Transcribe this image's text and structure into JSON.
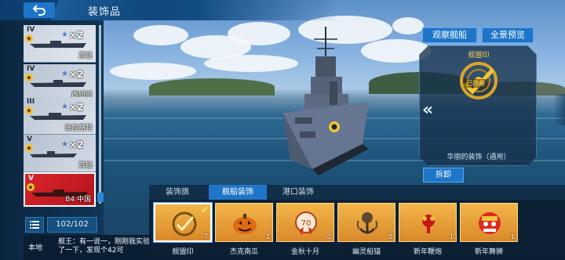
{
  "header": {
    "title": "装饰品"
  },
  "ship_list": [
    {
      "tier": "IV",
      "multiplier": "×2",
      "name": "苏联",
      "selected": false
    },
    {
      "tier": "IV",
      "multiplier": "×2",
      "name": "西姆斯",
      "selected": false
    },
    {
      "tier": "III",
      "multiplier": "×2",
      "name": "法拉格特",
      "selected": false
    },
    {
      "tier": "V",
      "multiplier": "×2",
      "name": "苏联",
      "selected": false
    },
    {
      "tier": "V",
      "multiplier": "",
      "name": "B4 中国",
      "selected": true
    }
  ],
  "ship_count": "102/102",
  "chat": {
    "channel": "本地",
    "message": "舰王：有一说一，刚刚我实验了一下，发现个42可"
  },
  "top_buttons": {
    "observe": "观察舰船",
    "panorama": "全景预览"
  },
  "detail": {
    "item_name": "舰盟印",
    "equipped_label": "已装备",
    "description": "华丽的装饰（通用）",
    "remove_button": "拆卸"
  },
  "tabs": [
    {
      "label": "装饰旗",
      "active": false
    },
    {
      "label": "舰船装饰",
      "active": true
    },
    {
      "label": "港口装饰",
      "active": false
    }
  ],
  "items": [
    {
      "label": "舰盟印",
      "count": "7",
      "equipped": true,
      "icon": "emblem-icon"
    },
    {
      "label": "杰克南瓜",
      "count": "1",
      "equipped": false,
      "icon": "pumpkin-icon"
    },
    {
      "label": "金秋十月",
      "count": "0",
      "equipped": false,
      "icon": "autumn-badge-icon"
    },
    {
      "label": "幽灵船锚",
      "count": "0",
      "equipped": false,
      "icon": "ghost-anchor-icon"
    },
    {
      "label": "新年鞭炮",
      "count": "1",
      "equipped": false,
      "icon": "firecracker-icon"
    },
    {
      "label": "新年舞狮",
      "count": "1",
      "equipped": false,
      "icon": "lion-dance-icon"
    }
  ],
  "colors": {
    "accent": "#1f76c9",
    "item_gold": "#e9a23b",
    "selected_card": "#d9232b"
  }
}
